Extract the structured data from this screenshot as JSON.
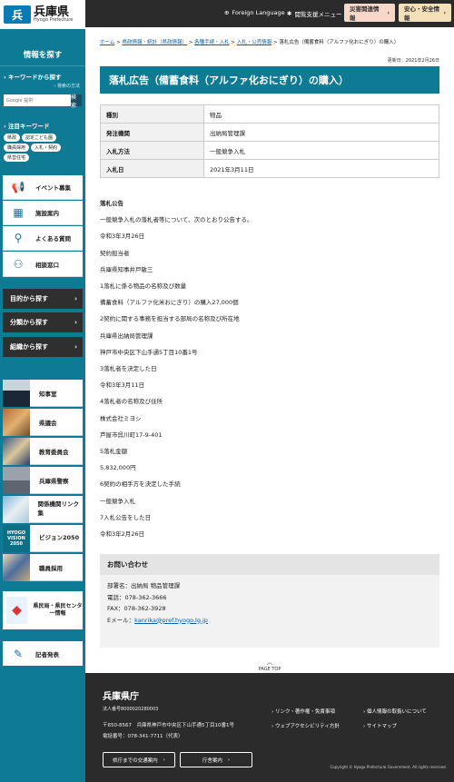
{
  "header": {
    "logo_mark": "兵",
    "logo_main": "兵庫県",
    "logo_sub": "Hyogo Prefecture",
    "foreign_language": "Foreign Language",
    "accessibility": "閲覧支援メニュー",
    "disaster_btn": "災害関連情報",
    "safety_btn": "安心・安全情報"
  },
  "sidebar": {
    "heading": "情報を探す",
    "keyword_title": "キーワードから探す",
    "search_howto": "検索の方法",
    "search_placeholder": "Google 提供",
    "search_button": "検 索",
    "popular_title": "注目キーワード",
    "keywords": [
      "県政",
      "認定こども園",
      "職員採用",
      "入札・契約",
      "県営住宅"
    ],
    "menu": [
      {
        "label": "イベント募集"
      },
      {
        "label": "施設案内"
      },
      {
        "label": "よくある質問"
      },
      {
        "label": "相談窓口"
      }
    ],
    "dark_menu": [
      {
        "label": "目的から探す"
      },
      {
        "label": "分類から探す"
      },
      {
        "label": "組織から探す"
      }
    ],
    "thumbs": [
      {
        "label": "知事室"
      },
      {
        "label": "県議会"
      },
      {
        "label": "教育委員会"
      },
      {
        "label": "兵庫県警察"
      },
      {
        "label": "関係機関リンク集"
      },
      {
        "label": "ビジョン2050"
      },
      {
        "label": "職員採用"
      }
    ],
    "center_info": "県民局・県民センター情報",
    "press": "記者発表"
  },
  "breadcrumb": {
    "home": "ホーム",
    "c1": "県政情報・統計（県政情報）",
    "c2": "各種手続・入札",
    "c3": "入札・公売情報",
    "current": "落札広告（備蓄食料（アルファ化おにぎり）の購入）",
    "sep": ">"
  },
  "updated": "更新日：2021年2月26日",
  "title": "落札広告（備蓄食料（アルファ化おにぎり）の購入）",
  "info_table": [
    {
      "key": "種別",
      "value": "物品"
    },
    {
      "key": "発注機関",
      "value": "出納局管理課"
    },
    {
      "key": "入札方法",
      "value": "一般競争入札"
    },
    {
      "key": "入札日",
      "value": "2021年3月11日"
    }
  ],
  "body_heading": "落札公告",
  "body_lines": [
    "一般競争入札の落札者等について、次のとおり公告する。",
    "令和3年3月26日",
    "契約担当者",
    "兵庫県知事井戸敏三",
    "1落札に係る物品の名称及び数量",
    "備蓄食料（アルファ化米おにぎり）の購入27,000個",
    "2契約に関する事務を担当する部局の名称及び所在地",
    "兵庫県出納局管理課",
    "神戸市中央区下山手通5丁目10番1号",
    "3落札者を決定した日",
    "令和3年3月11日",
    "4落札者の名称及び住所",
    "株式会社ミヨシ",
    "芦屋市呉川町17-9-401",
    "5落札金額",
    "5,832,000円",
    "6契約の相手方を決定した手続",
    "一般競争入札",
    "7入札公告をした日",
    "令和3年2月26日"
  ],
  "contact": {
    "heading": "お問い合わせ",
    "dept": "部署名：出納局 物品管理課",
    "tel": "電話：078-362-3666",
    "fax": "FAX：078-362-3928",
    "email_label": "Eメール：",
    "email": "kanrika@pref.hyogo.lg.jp"
  },
  "page_top": "PAGE TOP",
  "footer": {
    "name": "兵庫県庁",
    "corp_no": "法人番号8000020280003",
    "address": "〒650-8567　兵庫県神戸市中央区下山手通5丁目10番1号",
    "phone": "電話番号：078-341-7711（代表）",
    "links": [
      "リンク・著作権・免責事項",
      "個人情報の取扱いについて",
      "ウェブアクセシビリティ方針",
      "サイトマップ"
    ],
    "btn_transport": "県庁までの交通案内",
    "btn_map": "庁舎案内",
    "copyright": "Copyright © Hyogo Prefectural Government. All rights reserved."
  }
}
